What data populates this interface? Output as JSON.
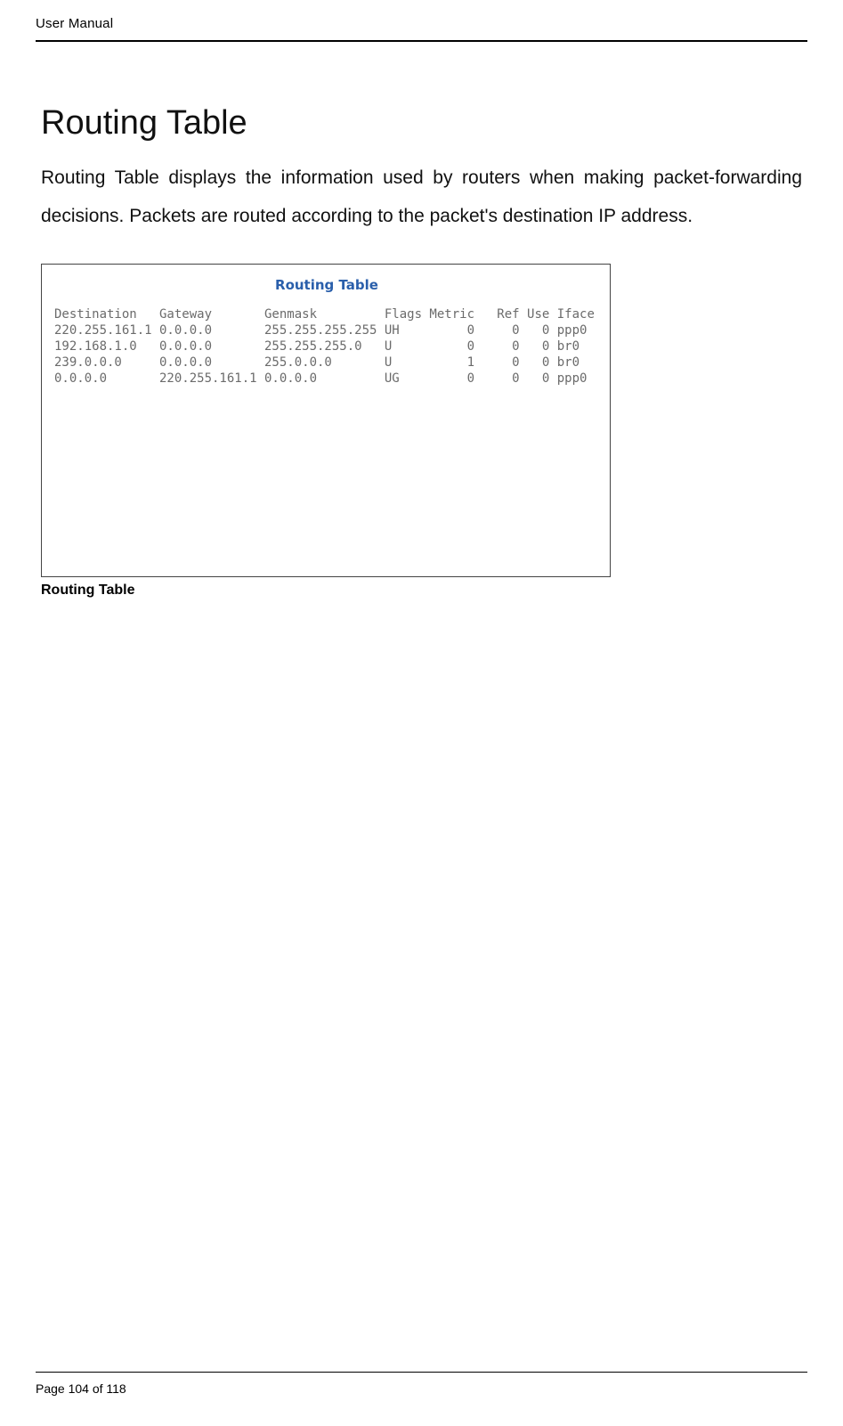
{
  "header": {
    "doc_label": "User Manual"
  },
  "section": {
    "title": "Routing Table",
    "body": "Routing Table displays the information used by routers when making packet-forwarding decisions. Packets are routed according to the packet's destination IP address."
  },
  "figure": {
    "title": "Routing Table",
    "caption": "Routing Table",
    "columns": [
      "Destination",
      "Gateway",
      "Genmask",
      "Flags",
      "Metric",
      "Ref",
      "Use",
      "Iface"
    ],
    "widths": [
      14,
      14,
      16,
      6,
      7,
      6,
      4,
      6
    ],
    "rows": [
      {
        "Destination": "220.255.161.1",
        "Gateway": "0.0.0.0",
        "Genmask": "255.255.255.255",
        "Flags": "UH",
        "Metric": "0",
        "Ref": "0",
        "Use": "0",
        "Iface": "ppp0"
      },
      {
        "Destination": "192.168.1.0",
        "Gateway": "0.0.0.0",
        "Genmask": "255.255.255.0",
        "Flags": "U",
        "Metric": "0",
        "Ref": "0",
        "Use": "0",
        "Iface": "br0"
      },
      {
        "Destination": "239.0.0.0",
        "Gateway": "0.0.0.0",
        "Genmask": "255.0.0.0",
        "Flags": "U",
        "Metric": "1",
        "Ref": "0",
        "Use": "0",
        "Iface": "br0"
      },
      {
        "Destination": "0.0.0.0",
        "Gateway": "220.255.161.1",
        "Genmask": "0.0.0.0",
        "Flags": "UG",
        "Metric": "0",
        "Ref": "0",
        "Use": "0",
        "Iface": "ppp0"
      }
    ]
  },
  "footer": {
    "page_label": "Page 104 of 118"
  }
}
